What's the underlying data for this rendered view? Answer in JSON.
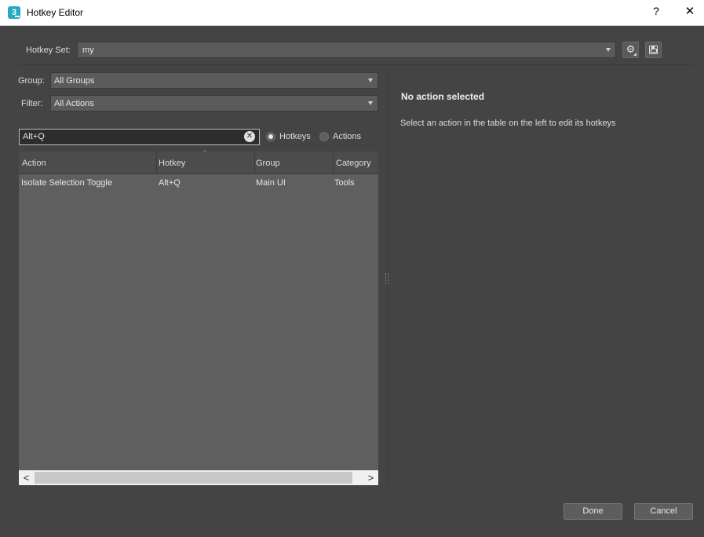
{
  "window": {
    "title": "Hotkey Editor",
    "help_label": "?",
    "close_label": "✕",
    "app_icon_text": "3"
  },
  "hotkey_set": {
    "label": "Hotkey Set:",
    "value": "my",
    "icons": [
      "gear-icon",
      "save-icon"
    ]
  },
  "group": {
    "label": "Group:",
    "value": "All Groups"
  },
  "filter": {
    "label": "Filter:",
    "value": "All Actions"
  },
  "search": {
    "value": "Alt+Q",
    "clear_icon": "✕",
    "modes": [
      {
        "label": "Hotkeys",
        "checked": true
      },
      {
        "label": "Actions",
        "checked": false
      }
    ]
  },
  "table": {
    "columns": [
      "Action",
      "Hotkey",
      "Group",
      "Category"
    ],
    "sort_indicator": "^",
    "rows": [
      {
        "action": "Isolate Selection Toggle",
        "hotkey": "Alt+Q",
        "group": "Main UI",
        "category": "Tools"
      }
    ],
    "scroll_left": "<",
    "scroll_right": ">"
  },
  "detail": {
    "title": "No action selected",
    "description": "Select an action in the table on the left to edit its hotkeys"
  },
  "buttons": {
    "done": "Done",
    "cancel": "Cancel"
  },
  "colors": {
    "background": "#444444",
    "field": "#5b5b5b",
    "table_body": "#5f5f5f",
    "search_field": "#2d2d2d",
    "app_icon": "#24a9c4"
  }
}
